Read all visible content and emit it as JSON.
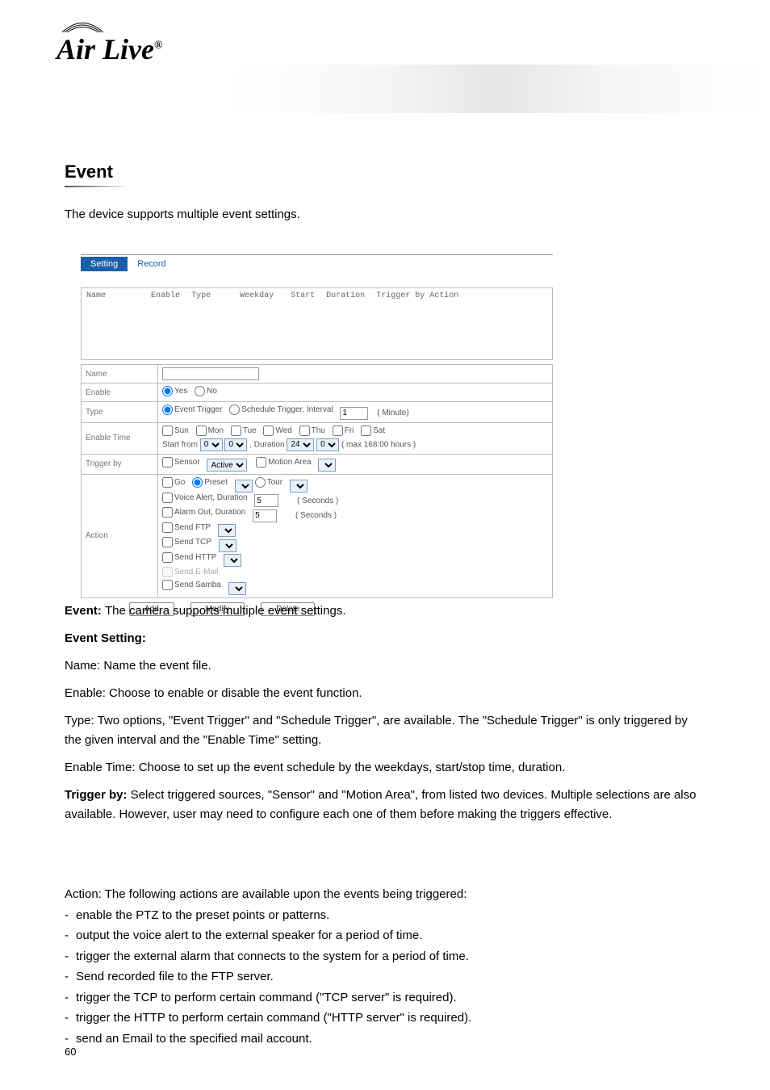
{
  "logo": {
    "text": "Air Live"
  },
  "section": {
    "title": "Event",
    "intro": "The device supports multiple event settings."
  },
  "screenshot": {
    "tabs": {
      "active": "Setting",
      "inactive": "Record"
    },
    "listHeaders": {
      "name": "Name",
      "enable": "Enable",
      "type": "Type",
      "weekday": "Weekday",
      "start": "Start",
      "duration": "Duration",
      "triggerBy": "Trigger by Action"
    },
    "form": {
      "name": {
        "label": "Name",
        "value": ""
      },
      "enable": {
        "label": "Enable",
        "yes": "Yes",
        "no": "No"
      },
      "type": {
        "label": "Type",
        "event": "Event Trigger",
        "schedule": "Schedule Trigger, Interval",
        "intervalValue": "1",
        "minute": "( Minute)"
      },
      "enableTime": {
        "label": "Enable Time",
        "days": [
          "Sun",
          "Mon",
          "Tue",
          "Wed",
          "Thu",
          "Fri",
          "Sat"
        ],
        "startFrom": "Start from",
        "h1": "0",
        "m1": "0",
        "durationLabel": ", Duration",
        "h2": "24",
        "m2": "0",
        "max": "( max 168:00 hours )"
      },
      "triggerBy": {
        "label": "Trigger by",
        "sensor": "Sensor",
        "sensorValue": "Active",
        "motion": "Motion Area"
      },
      "action": {
        "label": "Action",
        "go": "Go",
        "preset": "Preset",
        "tour": "Tour",
        "voiceAlert": "Voice Alert, Duration",
        "voiceVal": "5",
        "seconds": "( Seconds )",
        "alarmOut": "Alarm Out, Duration",
        "alarmVal": "5",
        "sendFtp": "Send FTP",
        "sendTcp": "Send TCP",
        "sendHttp": "Send HTTP",
        "sendEmail": "Send E-Mail",
        "sendSamba": "Send Samba"
      }
    },
    "buttons": {
      "add": "Add",
      "modify": "Modify",
      "delete": "Delete"
    }
  },
  "body": {
    "eventLabel": "Event: ",
    "eventText": "The camera supports multiple event settings.",
    "setting": "Event Setting:",
    "name": "Name: Name the event file.",
    "enable": "Enable: Choose to enable or disable the event function.",
    "type": "Type: Two options, \"Event Trigger\" and \"Schedule Trigger\", are available. The \"Schedule Trigger\" is only triggered by the given interval and the \"Enable Time\" setting.",
    "enableTime": "Enable Time: Choose to set up the event schedule by the weekdays, start/stop time, duration."
  },
  "triggerBy": {
    "label": "Trigger by:",
    "text": " Select triggered sources, \"Sensor\" and \"Motion Area\", from listed two devices. Multiple selections are also available. However, user may need to configure each one of them before making the triggers effective."
  },
  "action": {
    "label": "Action: ",
    "intro": "The following actions are available upon the events being triggered:",
    "bullet1": "enable the PTZ to the preset points or patterns.",
    "bullet2": "output the voice alert to the external speaker for a period of time.",
    "bullet3": "trigger the external alarm that connects to the system for a period of time.",
    "bullet4": "Send recorded file to the FTP server.",
    "bullet5": "trigger the TCP to perform certain command (\"TCP server\" is required).",
    "bullet6": "trigger the HTTP to perform certain command (\"HTTP server\" is required).",
    "bullet7": "send an Email to the specified mail account."
  },
  "pageNum": "60"
}
